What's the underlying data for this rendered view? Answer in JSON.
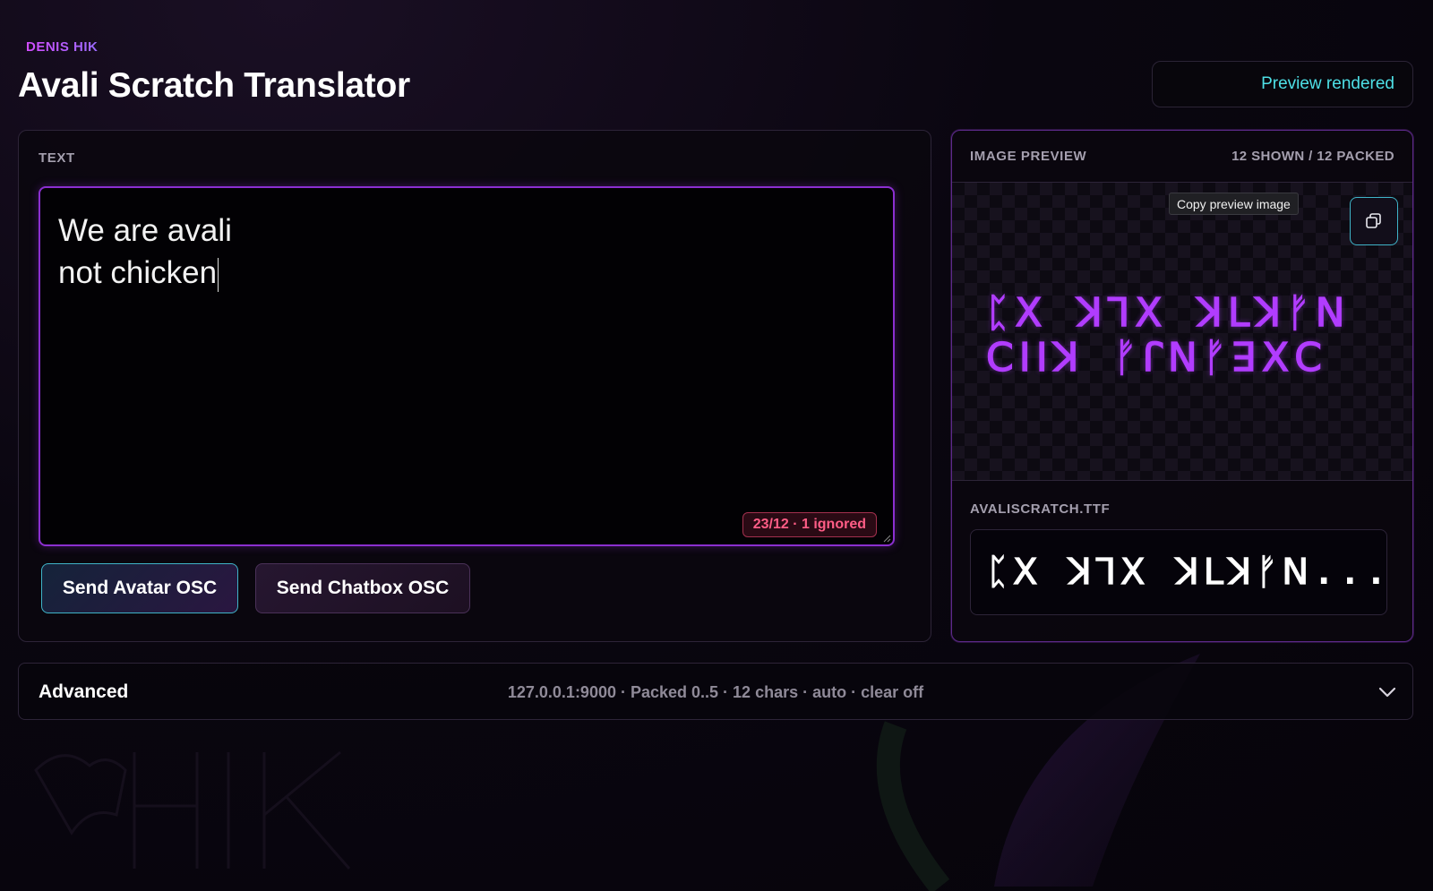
{
  "header": {
    "brand": "DENIS HIK",
    "title": "Avali Scratch Translator",
    "status": "Preview rendered"
  },
  "text_panel": {
    "label": "TEXT",
    "input_lines": [
      "We are avali",
      "not chicken"
    ],
    "counter": "23/12 · 1 ignored"
  },
  "buttons": {
    "avatar": "Send Avatar OSC",
    "chatbox": "Send Chatbox OSC"
  },
  "preview": {
    "label": "IMAGE PREVIEW",
    "count": "12 SHOWN / 12 PACKED",
    "tooltip": "Copy preview image",
    "copy_icon": "copy-icon",
    "glyph_line_1": "ᛈꓫ ꓘꓶꓫ ꓘꓡꓘᚠꓠ",
    "glyph_line_2": "ꓚꓲꓲꓘ ᚠꓩꓠᚠꓱꓫꓚ"
  },
  "font": {
    "label": "AVALISCRATCH.TTF",
    "preview_glyphs": "ᛈꓫ ꓘꓶꓫ ꓘꓡꓘᚠꓠ..."
  },
  "advanced": {
    "title": "Advanced",
    "summary": "127.0.0.1:9000 · Packed 0..5 · 12 chars · auto · clear off",
    "chevron_icon": "chevron-down-icon"
  },
  "colors": {
    "accent_purple": "#8b2fd0",
    "glyph_purple": "#b13cff",
    "status_cyan": "#4ee0e6",
    "error_pink": "#ff5d86"
  }
}
